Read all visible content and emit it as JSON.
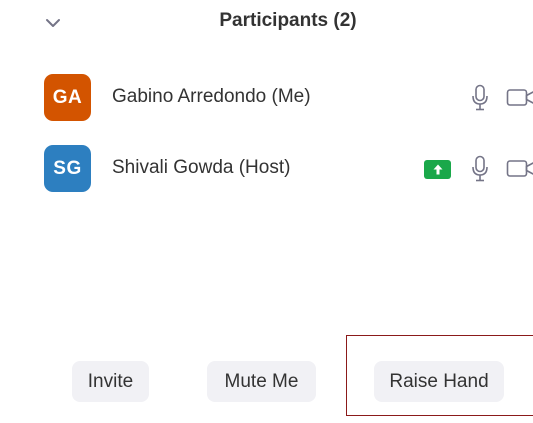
{
  "header": {
    "title": "Participants (2)",
    "collapse_icon": "chevron-down-icon"
  },
  "participants": [
    {
      "initials": "GA",
      "name": "Gabino Arredondo (Me)",
      "avatar_color": "#d35400",
      "screen_sharing": false,
      "icons": [
        "microphone-icon",
        "camera-icon"
      ]
    },
    {
      "initials": "SG",
      "name": "Shivali Gowda (Host)",
      "avatar_color": "#2d7fc0",
      "screen_sharing": true,
      "share_color": "#1aa84a",
      "icons": [
        "share-screen-icon",
        "microphone-icon",
        "camera-icon"
      ]
    }
  ],
  "footer": {
    "invite_label": "Invite",
    "mute_label": "Mute Me",
    "raise_hand_label": "Raise Hand"
  },
  "colors": {
    "button_bg": "#f1f1f5",
    "text": "#333333",
    "icon": "#747487",
    "highlight_border": "#8b1a1a"
  }
}
